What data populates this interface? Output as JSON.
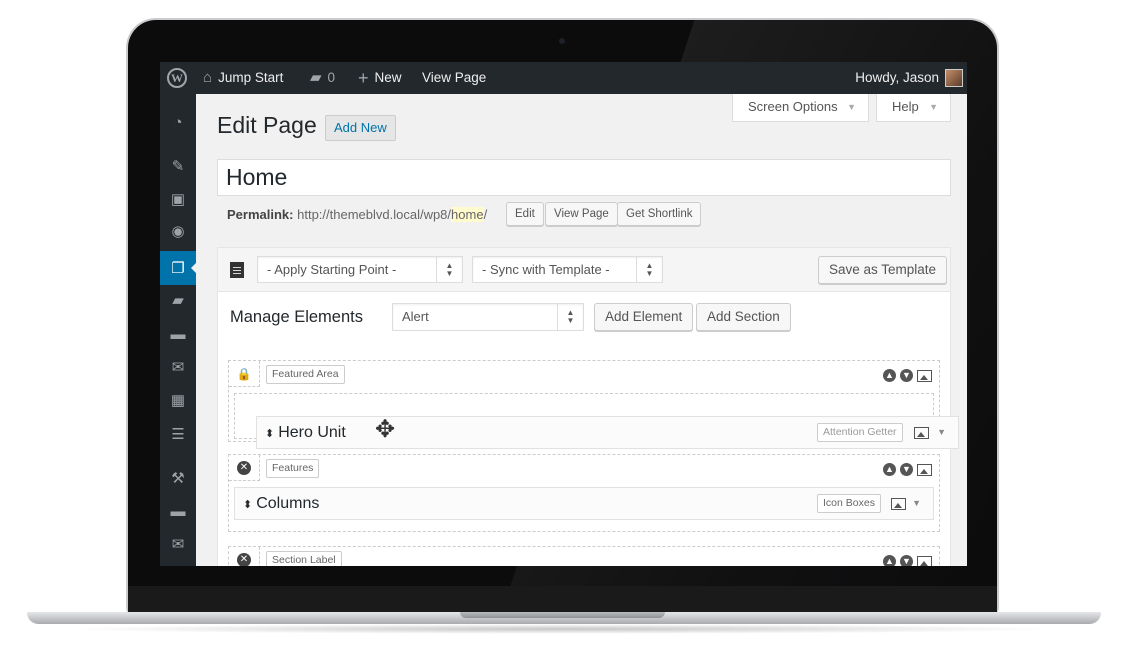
{
  "admin_bar": {
    "site_name": "Jump Start",
    "comments_count": "0",
    "new_label": "New",
    "view_page_label": "View Page",
    "howdy": "Howdy, Jason"
  },
  "screen_meta": {
    "screen_options": "Screen Options",
    "help": "Help"
  },
  "header": {
    "title": "Edit Page",
    "add_new": "Add New"
  },
  "post": {
    "title_value": "Home",
    "permalink_label": "Permalink:",
    "permalink_base": "http://themeblvd.local/wp8/",
    "permalink_slug": "home",
    "permalink_trailing": "/",
    "edit_button": "Edit",
    "view_button": "View Page",
    "shortlink_button": "Get Shortlink"
  },
  "builder": {
    "starting_point": "- Apply Starting Point -",
    "sync_template": "- Sync with Template -",
    "save_template": "Save as Template",
    "manage_title": "Manage Elements",
    "element_select": "Alert",
    "add_element": "Add Element",
    "add_section": "Add Section",
    "sections": [
      {
        "label": "Featured Area"
      },
      {
        "label": "Features"
      },
      {
        "label": "Section Label"
      }
    ],
    "elements": [
      {
        "name": "Hero Unit",
        "type": "Attention Getter"
      },
      {
        "name": "Columns",
        "type": "Icon Boxes"
      }
    ]
  }
}
